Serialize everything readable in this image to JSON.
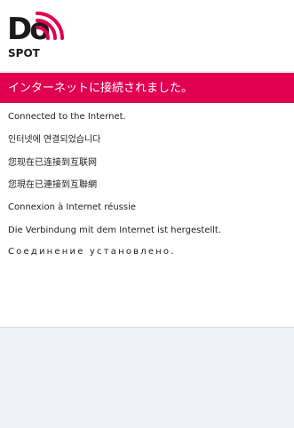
{
  "brand": {
    "logo_main": "Do",
    "logo_sub": "SPOT",
    "accent_color": "#e0004f",
    "logo_icon": "wifi-signal-icon"
  },
  "banner": {
    "text": "インターネットに接続されました。"
  },
  "messages": {
    "english": "Connected to the Internet.",
    "korean": "인터넷에 연결되었습니다",
    "chinese_simplified": "您现在已连接到互联网",
    "chinese_traditional": "您現在已連接到互聯網",
    "french": "Connexion à Internet réussie",
    "german": "Die Verbindung mit dem Internet ist hergestellt.",
    "russian": "Соединение установлено."
  }
}
